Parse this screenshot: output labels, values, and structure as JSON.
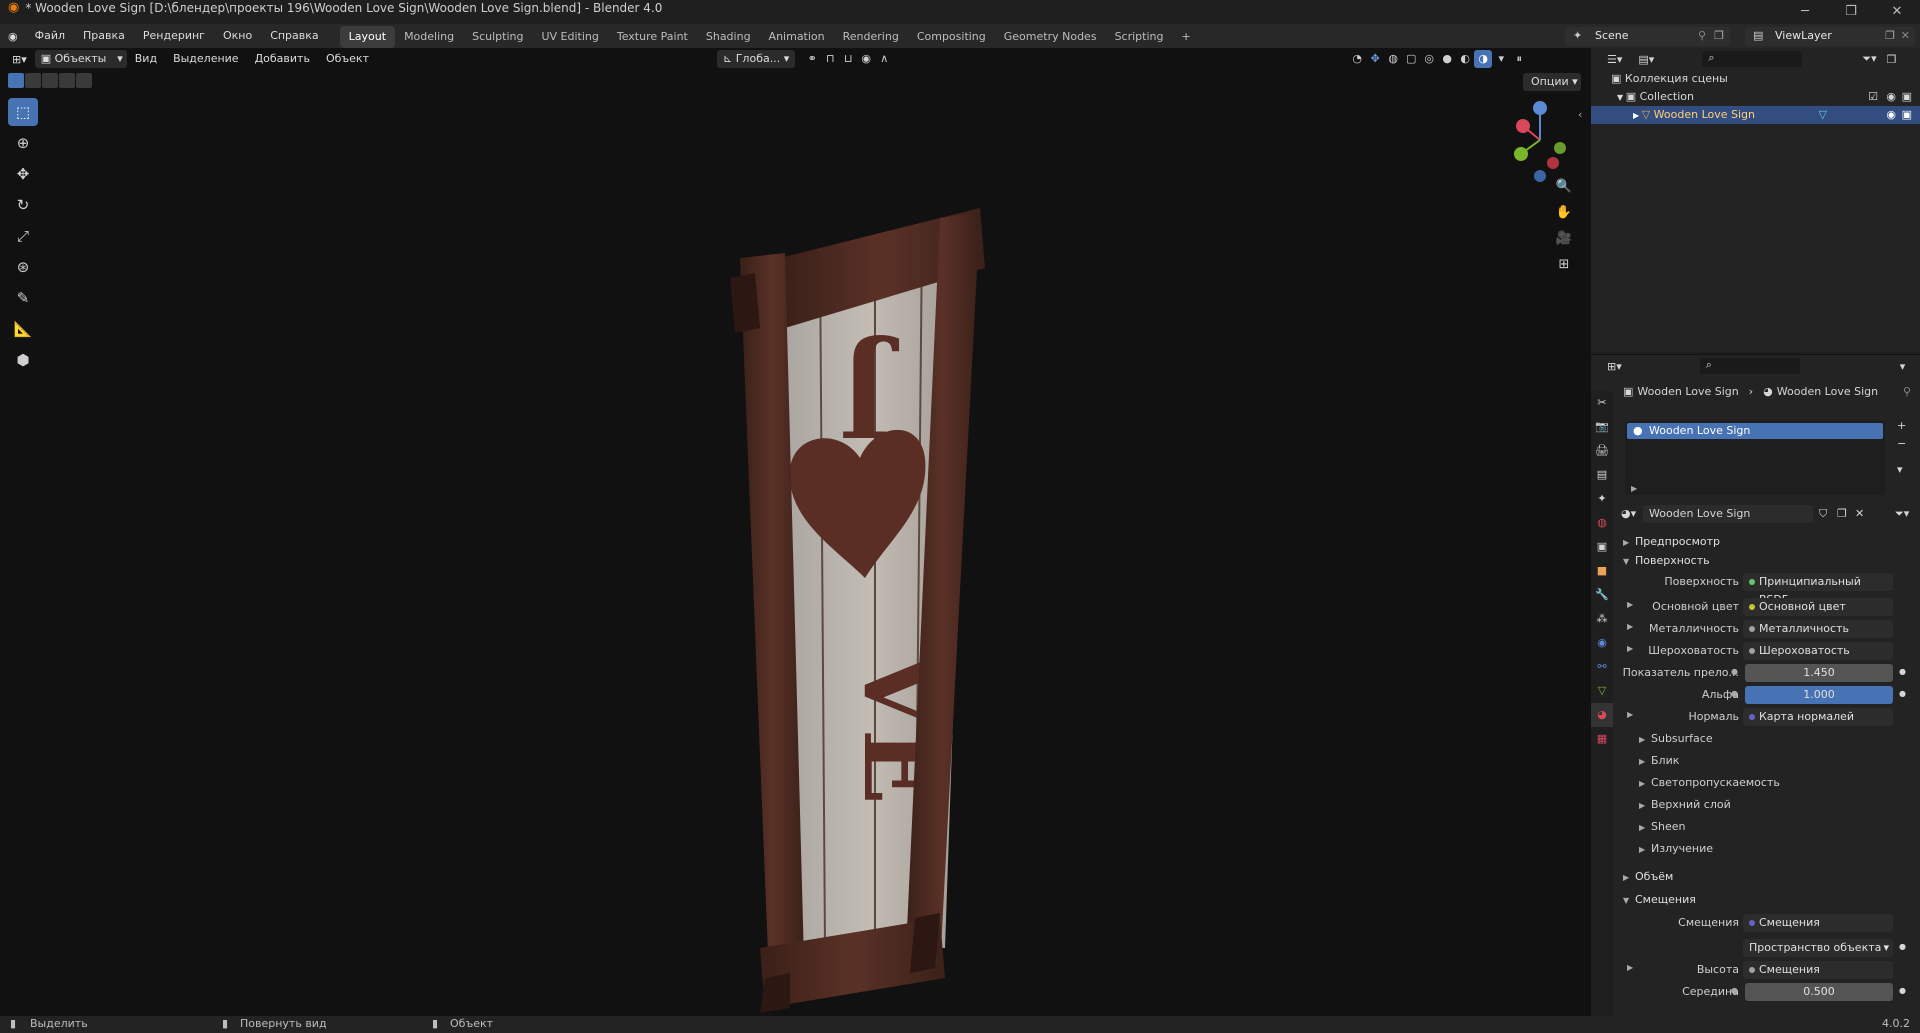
{
  "titlebar": {
    "title": "* Wooden Love Sign [D:\\блендер\\проекты 196\\Wooden Love Sign\\Wooden Love Sign.blend] - Blender 4.0",
    "minimize": "─",
    "maximize": "❐",
    "close": "✕"
  },
  "menubar": {
    "menus": [
      "Файл",
      "Правка",
      "Рендеринг",
      "Окно",
      "Справка"
    ],
    "workspaces": [
      "Layout",
      "Modeling",
      "Sculpting",
      "UV Editing",
      "Texture Paint",
      "Shading",
      "Animation",
      "Rendering",
      "Compositing",
      "Geometry Nodes",
      "Scripting"
    ],
    "active_workspace": "Layout",
    "add_tab": "+",
    "scene": "Scene",
    "view_layer": "ViewLayer"
  },
  "viewport": {
    "mode": "Объекты",
    "menus": [
      "Вид",
      "Выделение",
      "Добавить",
      "Объект"
    ],
    "transform_orientation": "Глоба...",
    "options": "Опции",
    "sign_text": "J",
    "sign_text2": "VE"
  },
  "outliner": {
    "root": "Коллекция сцены",
    "collection": "Collection",
    "object": "Wooden Love Sign"
  },
  "properties": {
    "breadcrumb_object": "Wooden Love Sign",
    "breadcrumb_material": "Wooden Love Sign",
    "slot": "Wooden Love Sign",
    "material_name": "Wooden Love Sign",
    "sections": {
      "preview": "Предпросмотр",
      "surface": "Поверхность",
      "volume": "Объём",
      "displacement": "Смещения"
    },
    "surface_label": "Поверхность",
    "surface_value": "Принципиальный BSDF",
    "base_color_label": "Основной цвет",
    "base_color_value": "Основной цвет",
    "metallic_label": "Металличность",
    "metallic_value": "Металличность",
    "roughness_label": "Шероховатость",
    "roughness_value": "Шероховатость",
    "ior_label": "Показатель прело...",
    "ior_value": "1.450",
    "alpha_label": "Альфа",
    "alpha_value": "1.000",
    "normal_label": "Нормаль",
    "normal_value": "Карта нормалей",
    "subpanels": [
      "Subsurface",
      "Блик",
      "Светопропускаемость",
      "Верхний слой",
      "Sheen",
      "Излучение"
    ],
    "disp_label": "Смещения",
    "disp_value": "Смещения",
    "space_value": "Пространство объекта",
    "height_label": "Высота",
    "height_value": "Смещения",
    "midlevel_label": "Середина",
    "midlevel_value": "0.500"
  },
  "statusbar": {
    "select": "Выделить",
    "rotate": "Повернуть вид",
    "object": "Объект",
    "version": "4.0.2"
  }
}
